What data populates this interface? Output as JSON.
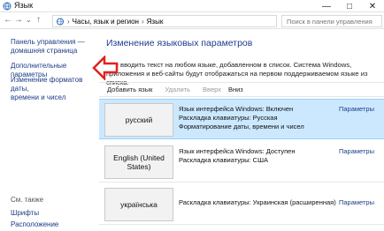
{
  "window": {
    "title": "Язык",
    "minimize": "—",
    "maximize": "□",
    "close": "✕"
  },
  "address": {
    "path": [
      "Часы, язык и регион",
      "Язык"
    ],
    "search_placeholder": "Поиск в панели управления"
  },
  "sidebar": {
    "links": [
      {
        "lines": [
          "Панель управления —",
          "домашняя страница"
        ]
      },
      {
        "lines": [
          "Дополнительные параметры"
        ]
      },
      {
        "lines": [
          "Изменение форматов даты,",
          "времени и чисел"
        ]
      }
    ],
    "see_also": "См. также",
    "bottom_links": [
      "Шрифты",
      "Расположение"
    ]
  },
  "main": {
    "title": "Изменение языковых параметров",
    "description": [
      "...те вводить текст на любом языке, добавленном в список. Система Windows,",
      "приложения и веб-сайты будут отображаться на первом поддерживаемом языке из списка."
    ],
    "toolbar": {
      "add": "Добавить язык",
      "remove": "Удалить",
      "up": "Вверх",
      "down": "Вниз"
    },
    "languages": [
      {
        "name": "русский",
        "info": [
          "Язык интерфейса Windows: Включен",
          "Раскладка клавиатуры: Русская",
          "Форматирование даты, времени и чисел"
        ],
        "params": "Параметры",
        "selected": true
      },
      {
        "name": "English (United States)",
        "info": [
          "Язык интерфейса Windows: Доступен",
          "Раскладка клавиатуры: США"
        ],
        "params": "Параметры",
        "selected": false
      },
      {
        "name": "українська",
        "info": [
          "Раскладка клавиатуры: Украинская (расширенная)"
        ],
        "params": "Параметры",
        "selected": false
      }
    ]
  },
  "colors": {
    "link": "#1c3d87",
    "title": "#1f3c8f",
    "selection": "#cce8ff",
    "arrow": "#e0221e"
  }
}
